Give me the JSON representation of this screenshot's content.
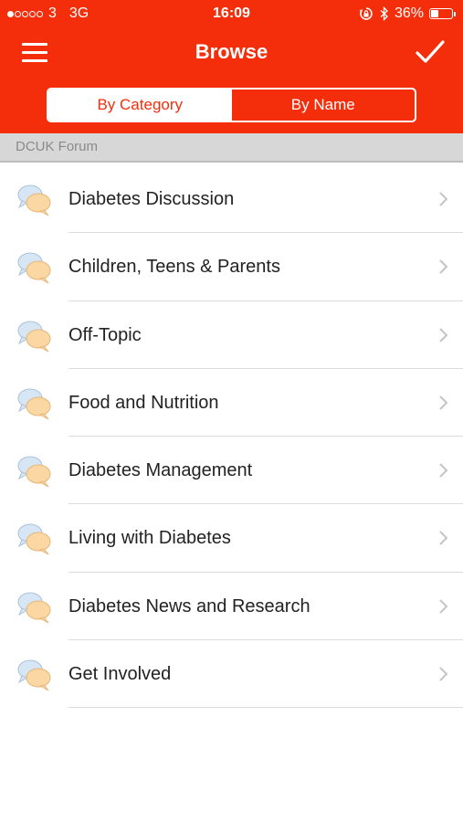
{
  "status_bar": {
    "signal_bars": 5,
    "signal_filled": 1,
    "carrier": "3",
    "network": "3G",
    "time": "16:09",
    "battery_percent": "36%",
    "battery_level": 0.36
  },
  "nav": {
    "title": "Browse",
    "left_icon": "hamburger-menu-icon",
    "right_icon": "checkmark-icon"
  },
  "segmented": {
    "options": [
      "By Category",
      "By Name"
    ],
    "selected": "By Category"
  },
  "section": {
    "title": "DCUK Forum"
  },
  "forums": [
    {
      "label": "Diabetes Discussion"
    },
    {
      "label": "Children, Teens & Parents"
    },
    {
      "label": "Off-Topic"
    },
    {
      "label": "Food and Nutrition"
    },
    {
      "label": "Diabetes Management"
    },
    {
      "label": "Living with Diabetes"
    },
    {
      "label": "Diabetes News and Research"
    },
    {
      "label": "Get Involved"
    }
  ],
  "colors": {
    "brand": "#f42e0a",
    "section_bg": "#d7d7d7",
    "text": "#222222"
  }
}
